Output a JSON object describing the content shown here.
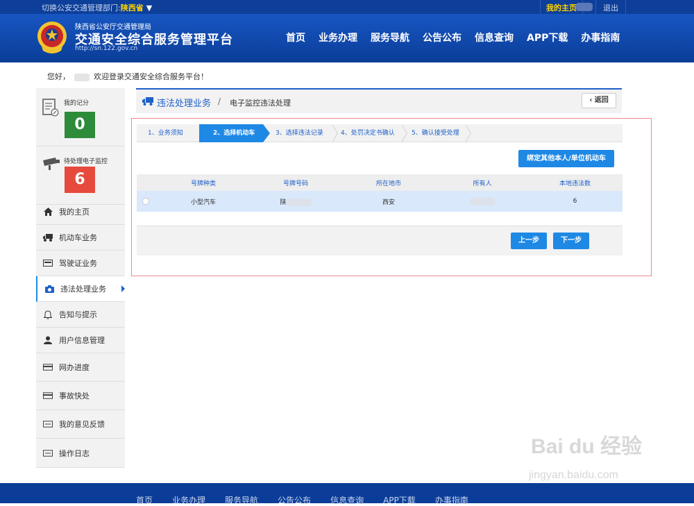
{
  "topbar": {
    "switch_label": "切换公安交通管理部门:",
    "province": "陕西省",
    "caret": "▼",
    "my_home": "我的主页",
    "logout": "退出"
  },
  "brand": {
    "sub": "陕西省公安厅交通管理局",
    "title": "交通安全综合服务管理平台",
    "url": "http://sn.122.gov.cn"
  },
  "nav": [
    "首页",
    "业务办理",
    "服务导航",
    "公告公布",
    "信息查询",
    "APP下载",
    "办事指南"
  ],
  "greeting": {
    "hello": "您好，",
    "welcome": "欢迎登录交通安全综合服务平台！"
  },
  "sidebar": {
    "score_label": "我的记分",
    "score_value": "0",
    "monitor_label": "待处理电子监控",
    "monitor_value": "6",
    "items": [
      "我的主页",
      "机动车业务",
      "驾驶证业务",
      "违法处理业务",
      "告知与提示",
      "用户信息管理",
      "网办进度",
      "事故快处",
      "我的意见反馈",
      "操作日志"
    ],
    "active_index": 3
  },
  "breadcrumb": {
    "section": "违法处理业务",
    "separator": "/",
    "page": "电子监控违法处理",
    "back": "返回"
  },
  "steps": [
    "1、业务须知",
    "2、选择机动车",
    "3、选择违法记录",
    "4、处罚决定书确认",
    "5、确认接受处理"
  ],
  "current_step": 2,
  "bind_button": "绑定其他本人/单位机动车",
  "table": {
    "headers": [
      "号牌种类",
      "号牌号码",
      "所在地市",
      "所有人",
      "本地违法数"
    ],
    "rows": [
      {
        "plate_type": "小型汽车",
        "plate_prefix": "陕",
        "city": "西安",
        "violations": "6"
      }
    ]
  },
  "buttons": {
    "prev": "上一步",
    "next": "下一步"
  },
  "footer_nav": [
    "首页",
    "业务办理",
    "服务导航",
    "公告公布",
    "信息查询",
    "APP下载",
    "办事指南"
  ],
  "watermark": {
    "line1": "Bai du 经验",
    "line2": "jingyan.baidu.com"
  },
  "colors": {
    "primary": "#1e88e5",
    "header": "#0b3d98",
    "score_green": "#2e8b3a",
    "monitor_red": "#e64a3c",
    "highlight": "#ffd400"
  }
}
